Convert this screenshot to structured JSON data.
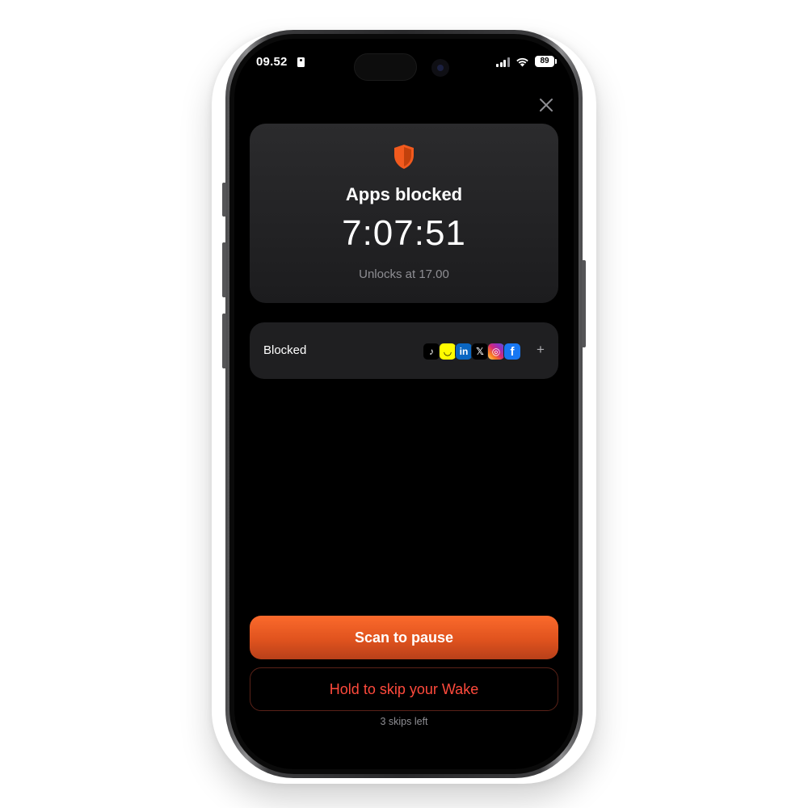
{
  "status_bar": {
    "time": "09.52",
    "battery": "89"
  },
  "card": {
    "title": "Apps blocked",
    "timer": "7:07:51",
    "unlock_text": "Unlocks at 17.00",
    "accent": "#f25a1e"
  },
  "blocked": {
    "label": "Blocked",
    "apps": [
      {
        "name": "TikTok",
        "icon": "tiktok-icon",
        "glyph": "♪",
        "color": "#000000"
      },
      {
        "name": "Snapchat",
        "icon": "snapchat-icon",
        "glyph": "◡",
        "color": "#fffc00"
      },
      {
        "name": "LinkedIn",
        "icon": "linkedin-icon",
        "glyph": "in",
        "color": "#0a66c2"
      },
      {
        "name": "X",
        "icon": "x-icon",
        "glyph": "𝕏",
        "color": "#000000"
      },
      {
        "name": "Instagram",
        "icon": "instagram-icon",
        "glyph": "◎",
        "color": "#d62976"
      },
      {
        "name": "Facebook",
        "icon": "facebook-icon",
        "glyph": "f",
        "color": "#1877f2"
      }
    ],
    "add_label": "+"
  },
  "actions": {
    "scan_label": "Scan to pause",
    "hold_label": "Hold to skip your Wake",
    "skips_text": "3 skips left"
  }
}
